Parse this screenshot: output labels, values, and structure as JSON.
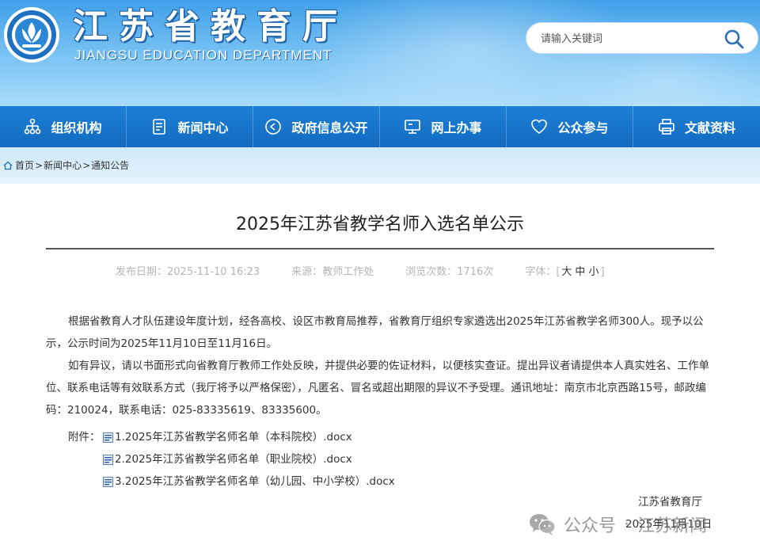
{
  "header": {
    "title_cn": "江苏省教育厅",
    "title_en": "JIANGSU EDUCATION DEPARTMENT",
    "search_placeholder": "请输入关键词"
  },
  "nav": {
    "items": [
      {
        "label": "组织机构",
        "icon": "org-chart-icon"
      },
      {
        "label": "新闻中心",
        "icon": "document-icon"
      },
      {
        "label": "政府信息公开",
        "icon": "play-circle-icon"
      },
      {
        "label": "网上办事",
        "icon": "monitor-icon"
      },
      {
        "label": "公众参与",
        "icon": "heart-icon"
      },
      {
        "label": "文献资料",
        "icon": "printer-icon"
      }
    ]
  },
  "breadcrumb": {
    "home": "首页",
    "news": "新闻中心",
    "notice": "通知公告",
    "sep": ">"
  },
  "article": {
    "title": "2025年江苏省教学名师入选名单公示",
    "meta": {
      "publish_label": "发布日期：",
      "publish_date": "2025-11-10 16:23",
      "source_label": "来源：",
      "source": "教师工作处",
      "views_label": "浏览次数：",
      "views": "1716次",
      "font_label": "字体：",
      "font_open": "[",
      "font_large": "大",
      "font_medium": "中",
      "font_small": "小",
      "font_close": "]"
    },
    "paragraph1": "根据省教育人才队伍建设年度计划，经各高校、设区市教育局推荐，省教育厅组织专家遴选出2025年江苏省教学名师300人。现予以公示，公示时间为2025年11月10日至11月16日。",
    "paragraph2": "如有异议，请以书面形式向省教育厅教师工作处反映，并提供必要的佐证材料，以便核实查证。提出异议者请提供本人真实姓名、工作单位、联系电话等有效联系方式（我厅将予以严格保密），凡匿名、冒名或超出期限的异议不予受理。通讯地址：南京市北京西路15号，邮政编码：210024，联系电话：025-83335619、83335600。",
    "attachments_label": "附件：",
    "attachments": [
      "1.2025年江苏省教学名师名单（本科院校）.docx",
      "2.2025年江苏省教学名师名单（职业院校）.docx",
      "3.2025年江苏省教学名师名单（幼儿园、中小学校）.docx"
    ],
    "sign_org": "江苏省教育厅",
    "sign_date": "2025年11月10日"
  },
  "watermark": {
    "text_left": "公众号",
    "dot": "·",
    "text_right": "江苏新闻"
  },
  "colors": {
    "nav_bg": "#1a78cf",
    "header_top": "#3f9fe8",
    "crumb_bg": "#d6ecfb"
  }
}
